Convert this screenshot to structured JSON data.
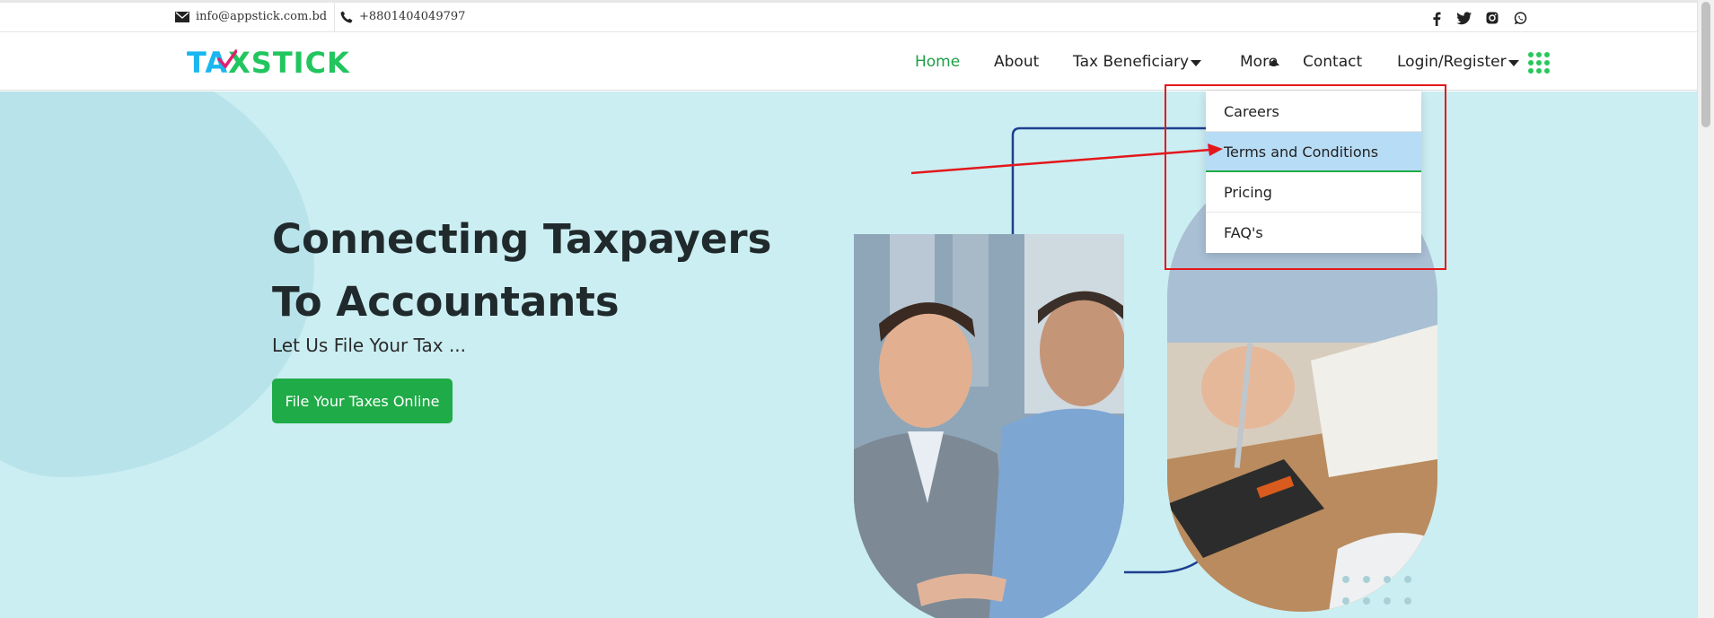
{
  "topbar": {
    "email": "info@appstick.com.bd",
    "phone": "+8801404049797",
    "icons": {
      "mail": "mail-icon",
      "phone": "phone-icon",
      "social": [
        "facebook-icon",
        "twitter-icon",
        "instagram-icon",
        "whatsapp-icon"
      ]
    }
  },
  "header": {
    "logo": {
      "part1": "TA",
      "part2": "XSTICK"
    },
    "nav": {
      "home": "Home",
      "about": "About",
      "tax_beneficiary": "Tax Beneficiary",
      "more": "More",
      "contact": "Contact",
      "login": "Login/Register"
    },
    "apps_icon": "grid-dots-icon"
  },
  "dropdown": {
    "items": [
      "Careers",
      "Terms and Conditions",
      "Pricing",
      "FAQ's"
    ],
    "hovered": "Terms and Conditions"
  },
  "hero": {
    "title": "Connecting Taxpayers To Accountants",
    "subtitle": "Let Us File Your Tax ...",
    "cta": "File Your Taxes Online"
  },
  "colors": {
    "accent_green": "#1fab47",
    "nav_active": "#1e9e46",
    "hero_bg": "#cbeef2",
    "annotation_red": "#e3171b",
    "hover_blue": "#b7dcf5"
  }
}
